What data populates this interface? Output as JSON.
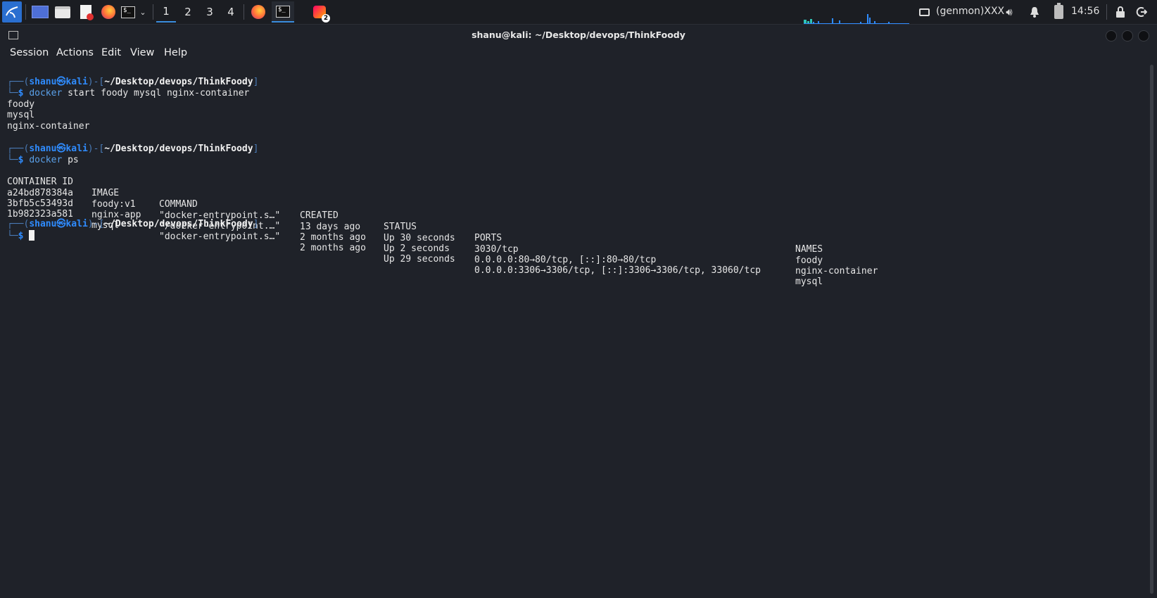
{
  "taskbar": {
    "workspaces": [
      "1",
      "2",
      "3",
      "4"
    ],
    "active_workspace": "1",
    "genmon": "(genmon)XXX",
    "clock": "14:56",
    "notification_badge": "2",
    "icons": [
      "kali-menu-icon",
      "show-desktop-icon",
      "file-manager-icon",
      "text-editor-icon",
      "firefox-icon",
      "terminal-icon",
      "chevron-down-icon",
      "firefox-icon",
      "terminal-icon",
      "screenshot-icon",
      "network-graph",
      "display-icon",
      "volume-icon",
      "bell-icon",
      "battery-icon",
      "lock-icon",
      "logout-icon"
    ]
  },
  "window": {
    "title": "shanu@kali: ~/Desktop/devops/ThinkFoody",
    "menu": [
      "Session",
      "Actions",
      "Edit",
      "View",
      "Help"
    ]
  },
  "terminal": {
    "prompt": {
      "open": "┌──(",
      "user": "shanu",
      "at": "㉿",
      "host": "kali",
      "mid": ")-[",
      "path": "~/Desktop/devops/ThinkFoody",
      "close": "]",
      "second_line": "└─",
      "dollar": "$"
    },
    "cmd1": {
      "bin": "docker",
      "args": " start foody mysql nginx-container"
    },
    "out1": [
      "foody",
      "mysql",
      "nginx-container"
    ],
    "cmd2": {
      "bin": "docker",
      "args": " ps"
    },
    "table": {
      "headers": [
        "CONTAINER ID",
        "IMAGE",
        "COMMAND",
        "CREATED",
        "STATUS",
        "PORTS",
        "NAMES"
      ],
      "rows": [
        [
          "a24bd878384a",
          "foody:v1",
          "\"docker-entrypoint.s…\"",
          "13 days ago",
          "Up 30 seconds",
          "3030/tcp",
          "foody"
        ],
        [
          "3bfb5c53493d",
          "nginx-app",
          "\"/docker-entrypoint.…\"",
          "2 months ago",
          "Up 2 seconds",
          "0.0.0.0:80→80/tcp, [::]:80→80/tcp",
          "nginx-container"
        ],
        [
          "1b982323a581",
          "mysql",
          "\"docker-entrypoint.s…\"",
          "2 months ago",
          "Up 29 seconds",
          "0.0.0.0:3306→3306/tcp, [::]:3306→3306/tcp, 33060/tcp",
          "mysql"
        ]
      ]
    }
  },
  "colors": {
    "accent": "#2f8cff",
    "background": "#1f2229",
    "taskbar": "#1b1d22"
  }
}
